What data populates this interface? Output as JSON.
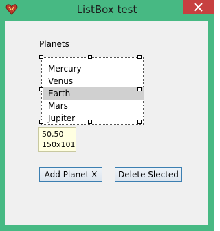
{
  "window": {
    "title": "ListBox test"
  },
  "colors": {
    "frame": "#47b983",
    "close_button": "#c74040",
    "client_bg": "#f0f0f0",
    "selected_item": "#d0d0d0",
    "tooltip_bg": "#ffffe1"
  },
  "icons": {
    "app": "heart-icon",
    "close": "close-icon"
  },
  "planets_label": "Planets",
  "listbox": {
    "items": [
      "Mercury",
      "Venus",
      "Earth",
      "Mars",
      "Jupiter"
    ],
    "selected": "Earth"
  },
  "tooltip": {
    "position": "50,50",
    "size": "150x101"
  },
  "buttons": {
    "add": "Add Planet X",
    "delete": "Delete Slected"
  }
}
